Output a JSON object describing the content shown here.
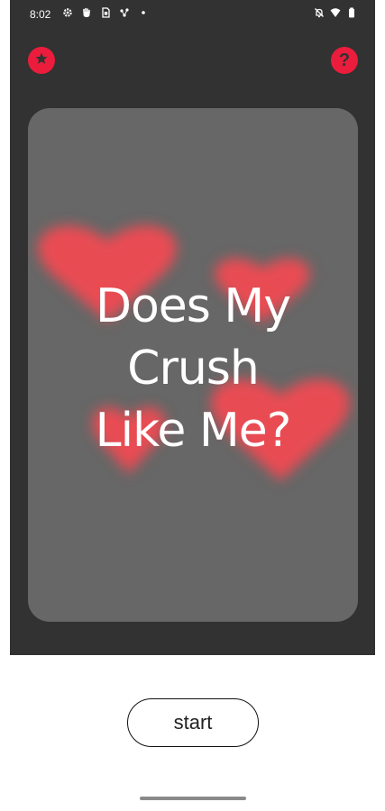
{
  "status_bar": {
    "time": "8:02",
    "left_icons": [
      "settings-icon",
      "hand-icon",
      "sim-card-icon",
      "network-icon",
      "dot-icon"
    ],
    "right_icons": [
      "notifications-off-icon",
      "wifi-icon",
      "battery-icon"
    ]
  },
  "header": {
    "favorites_icon": "star-icon",
    "help_icon": "help-icon",
    "help_glyph": "?"
  },
  "card": {
    "title_lines": [
      "Does My",
      "Crush",
      "Like Me?"
    ],
    "background_hearts": 4
  },
  "actions": {
    "start_label": "start"
  },
  "colors": {
    "app_background": "#323232",
    "card_background": "#676767",
    "accent": "#ec1c3c",
    "heart": "#e94b52",
    "title_text": "#ffffff"
  }
}
